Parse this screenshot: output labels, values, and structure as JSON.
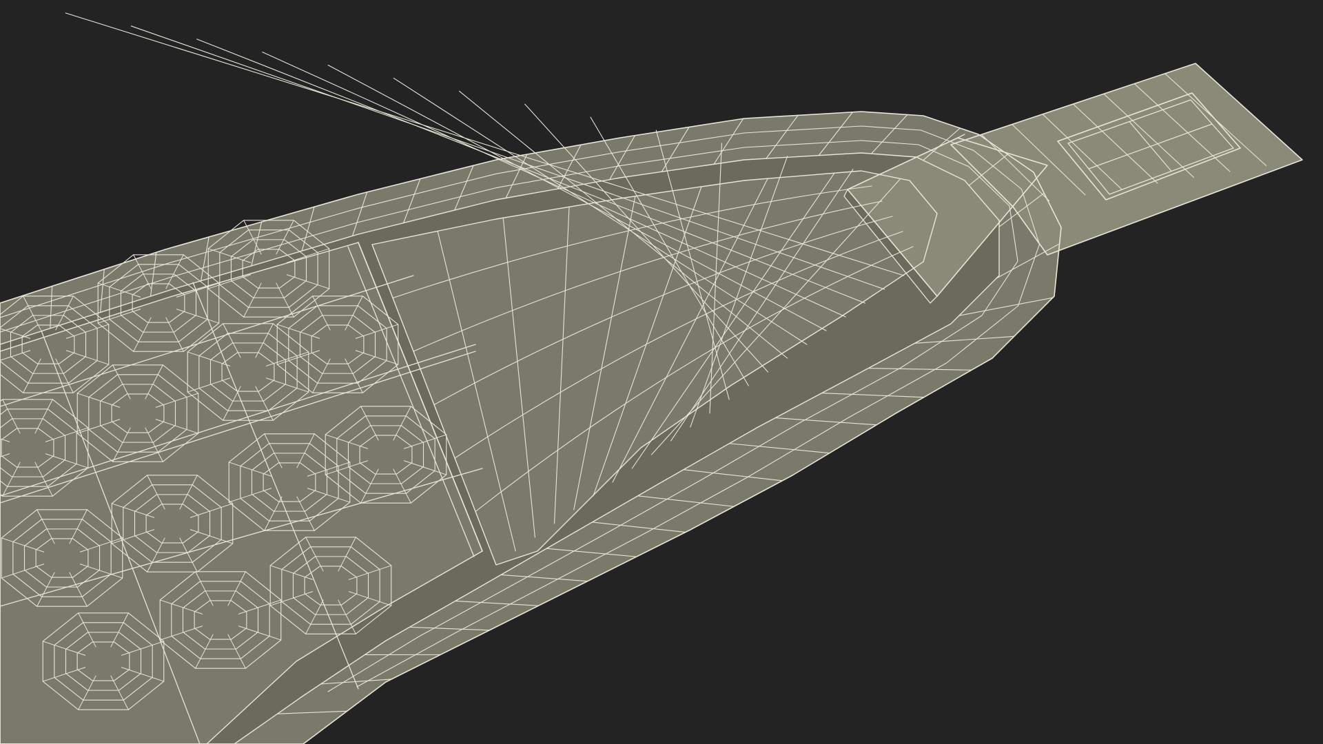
{
  "scene": {
    "background_color": "#232323",
    "mesh_fill_color": "#7a7a6a",
    "mesh_shade_color": "#6b6b5c",
    "mesh_highlight_color": "#8a8a78",
    "wire_color": "#e8e6d8",
    "subject": "wireframe-3d-model"
  }
}
